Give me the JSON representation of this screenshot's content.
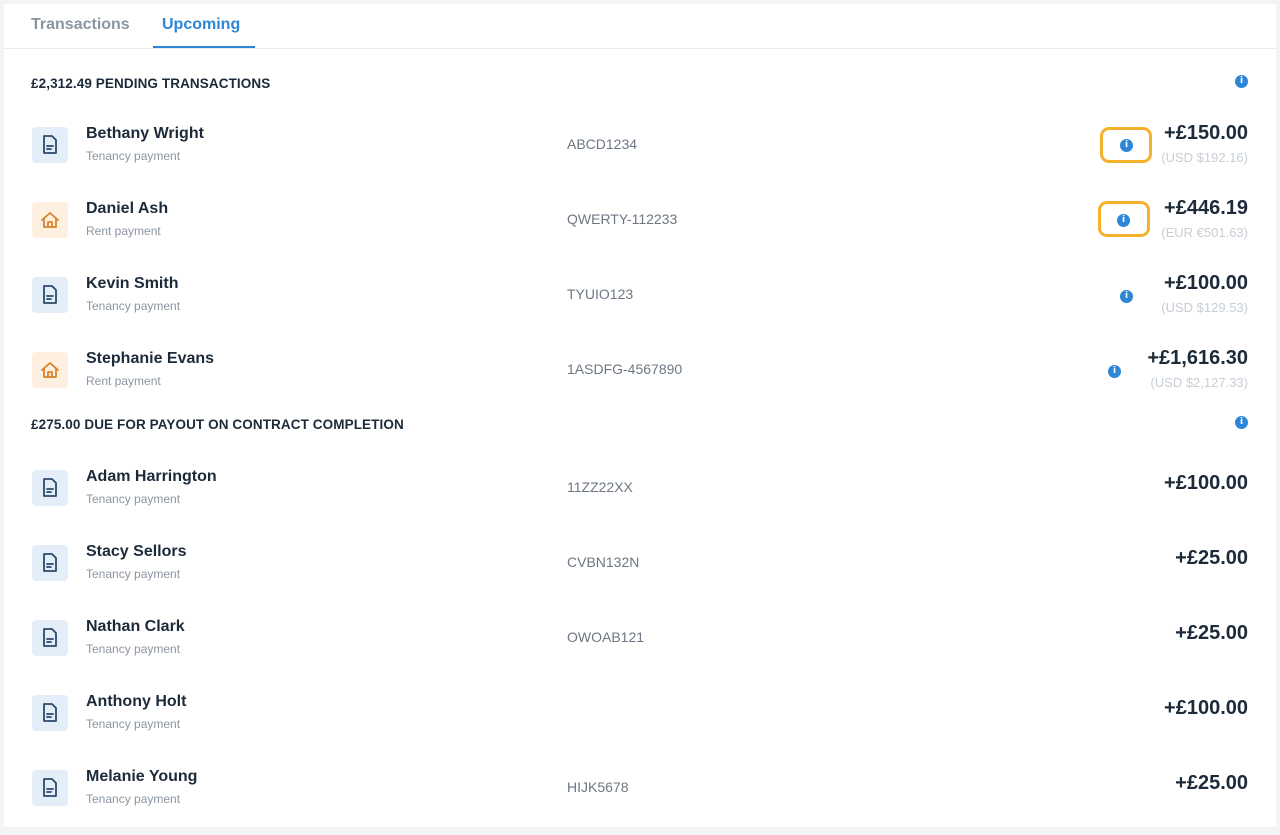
{
  "tabs": [
    {
      "label": "Transactions",
      "active": false
    },
    {
      "label": "Upcoming",
      "active": true
    }
  ],
  "sections": {
    "pending": {
      "title": "£2,312.49 PENDING TRANSACTIONS",
      "rows": [
        {
          "name": "Bethany Wright",
          "type": "Tenancy payment",
          "icon": "document-icon",
          "reference": "ABCD1234",
          "amount": "+£150.00",
          "converted": "(USD $192.16)"
        },
        {
          "name": "Daniel Ash",
          "type": "Rent payment",
          "icon": "house-icon",
          "reference": "QWERTY-112233",
          "amount": "+£446.19",
          "converted": "(EUR €501.63)"
        },
        {
          "name": "Kevin Smith",
          "type": "Tenancy payment",
          "icon": "document-icon",
          "reference": "TYUIO123",
          "amount": "+£100.00",
          "converted": "(USD $129.53)"
        },
        {
          "name": "Stephanie Evans",
          "type": "Rent payment",
          "icon": "house-icon",
          "reference": "1ASDFG-4567890",
          "amount": "+£1,616.30",
          "converted": "(USD $2,127.33)"
        }
      ]
    },
    "payout": {
      "title": "£275.00 DUE FOR PAYOUT ON CONTRACT COMPLETION",
      "rows": [
        {
          "name": "Adam Harrington",
          "type": "Tenancy payment",
          "icon": "document-icon",
          "reference": "11ZZ22XX",
          "amount": "+£100.00"
        },
        {
          "name": "Stacy Sellors",
          "type": "Tenancy payment",
          "icon": "document-icon",
          "reference": "CVBN132N",
          "amount": "+£25.00"
        },
        {
          "name": "Nathan Clark",
          "type": "Tenancy payment",
          "icon": "document-icon",
          "reference": "OWOAB121",
          "amount": "+£25.00"
        },
        {
          "name": "Anthony Holt",
          "type": "Tenancy payment",
          "icon": "document-icon",
          "reference": "",
          "amount": "+£100.00"
        },
        {
          "name": "Melanie Young",
          "type": "Tenancy payment",
          "icon": "document-icon",
          "reference": "HIJK5678",
          "amount": "+£25.00"
        }
      ]
    }
  },
  "info_icon_glyph": "i",
  "colors": {
    "accent": "#2d86d6",
    "highlight": "#f5b12b",
    "house_icon": "#d9822b"
  }
}
